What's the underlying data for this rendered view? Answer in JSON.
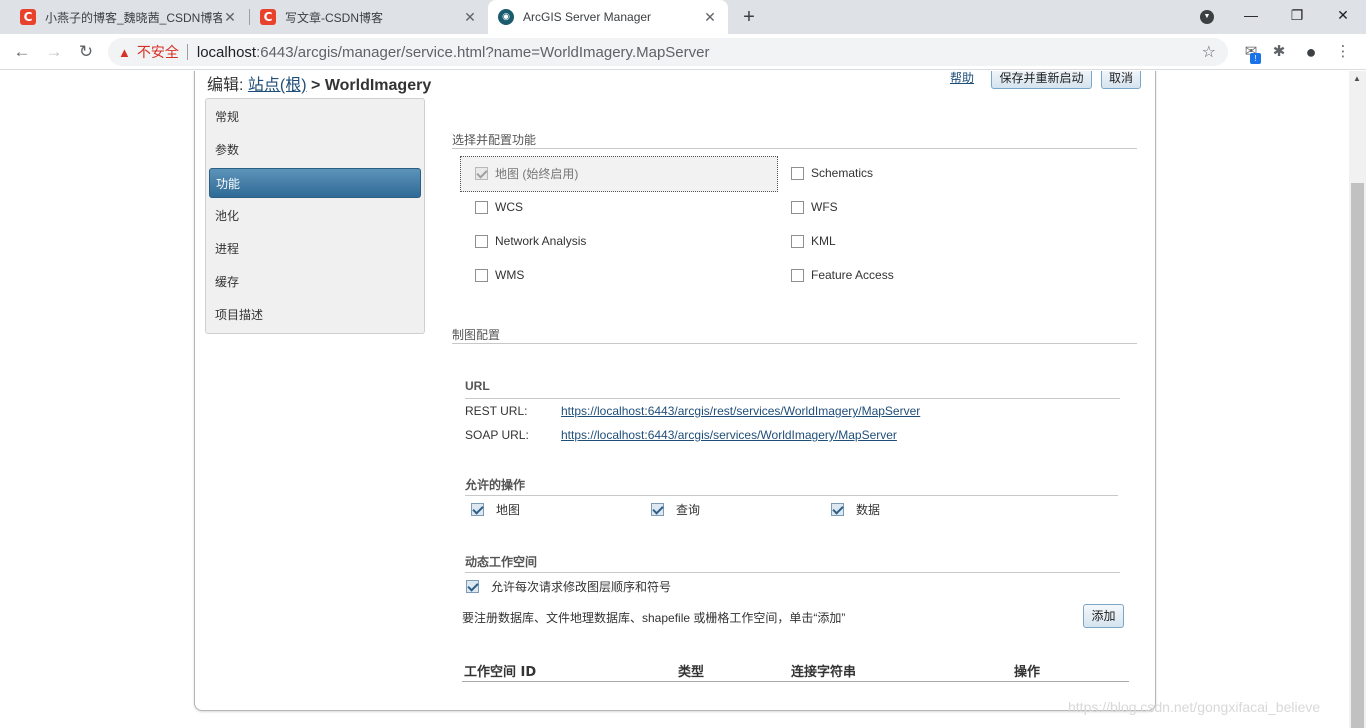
{
  "browser": {
    "tabs": [
      {
        "title": "小燕子的博客_魏晓茜_CSDN博客",
        "favicon": "csdn-icon",
        "active": false
      },
      {
        "title": "写文章-CSDN博客",
        "favicon": "csdn-icon",
        "active": false
      },
      {
        "title": "ArcGIS Server Manager",
        "favicon": "globe-icon",
        "active": true
      }
    ],
    "favicon_letter": "C",
    "new_tab_symbol": "+",
    "security_label": "不安全",
    "url_host": "localhost",
    "url_path": ":6443/arcgis/manager/service.html?name=WorldImagery.MapServer",
    "extension_badge": "!"
  },
  "header": {
    "edit_prefix": "编辑:",
    "breadcrumb_link": "站点(根)",
    "separator": ">",
    "service_name": "WorldImagery",
    "help_label": "帮助",
    "save_restart_label": "保存并重新启动",
    "cancel_label": "取消"
  },
  "sidebar": {
    "items": [
      {
        "label": "常规",
        "active": false
      },
      {
        "label": "参数",
        "active": false
      },
      {
        "label": "功能",
        "active": true
      },
      {
        "label": "池化",
        "active": false
      },
      {
        "label": "进程",
        "active": false
      },
      {
        "label": "缓存",
        "active": false
      },
      {
        "label": "项目描述",
        "active": false
      }
    ]
  },
  "capabilities": {
    "title": "选择并配置功能",
    "items": [
      {
        "label": "地图 (始终启用)",
        "checked": true,
        "disabled": true
      },
      {
        "label": "Schematics",
        "checked": false
      },
      {
        "label": "WCS",
        "checked": false
      },
      {
        "label": "WFS",
        "checked": false
      },
      {
        "label": "Network Analysis",
        "checked": false
      },
      {
        "label": "KML",
        "checked": false
      },
      {
        "label": "WMS",
        "checked": false
      },
      {
        "label": "Feature Access",
        "checked": false
      }
    ]
  },
  "mapping": {
    "title": "制图配置",
    "url_section": {
      "title": "URL",
      "rest_label": "REST URL:",
      "rest_url": "https://localhost:6443/arcgis/rest/services/WorldImagery/MapServer",
      "soap_label": "SOAP URL:",
      "soap_url": "https://localhost:6443/arcgis/services/WorldImagery/MapServer"
    },
    "operations": {
      "title": "允许的操作",
      "items": [
        {
          "label": "地图",
          "checked": true
        },
        {
          "label": "查询",
          "checked": true
        },
        {
          "label": "数据",
          "checked": true
        }
      ]
    },
    "dynamic_workspace": {
      "title": "动态工作空间",
      "allow_label": "允许每次请求修改图层顺序和符号",
      "allow_checked": true,
      "hint": "要注册数据库、文件地理数据库、shapefile 或栅格工作空间，单击“添加”",
      "add_label": "添加",
      "columns": [
        "工作空间 ID",
        "类型",
        "连接字符串",
        "操作"
      ]
    }
  },
  "watermark": "https://blog.csdn.net/gongxifacai_believe"
}
